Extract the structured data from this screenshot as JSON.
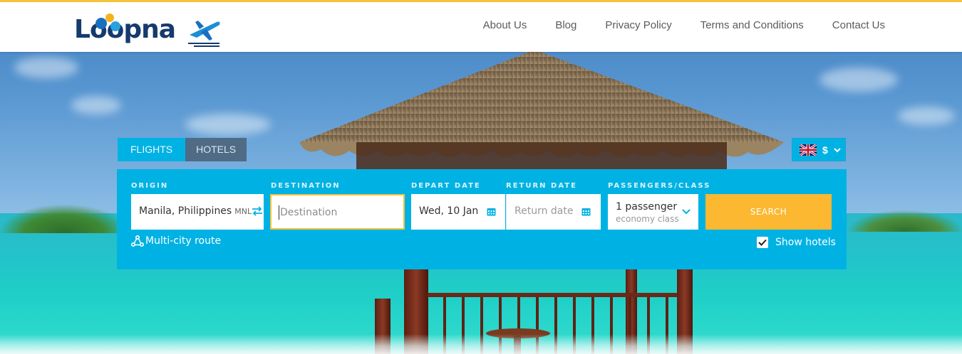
{
  "brand": {
    "logo_text": "Loopna",
    "colors": {
      "primary": "#00b2e3",
      "accent": "#f5c33b",
      "button": "#fbb830",
      "logo": "#153a6e"
    }
  },
  "nav": {
    "items": [
      "About Us",
      "Blog",
      "Privacy Policy",
      "Terms and Conditions",
      "Contact Us"
    ]
  },
  "tabs": {
    "flights": "FLIGHTS",
    "hotels": "HOTELS",
    "active": "FLIGHTS"
  },
  "currency": {
    "symbol": "$",
    "flag_icon": "uk-flag-icon"
  },
  "search": {
    "origin": {
      "label": "ORIGIN",
      "value": "Manila, Philippines",
      "code": "MNL"
    },
    "destination": {
      "label": "DESTINATION",
      "placeholder": "Destination"
    },
    "depart": {
      "label": "DEPART DATE",
      "value": "Wed, 10 Jan"
    },
    "return": {
      "label": "RETURN DATE",
      "placeholder": "Return date"
    },
    "passengers": {
      "label": "PASSENGERS/CLASS",
      "count": "1 passenger",
      "class": "economy class"
    },
    "search_button": "SEARCH",
    "multicity_label": "Multi-city route",
    "show_hotels_label": "Show hotels",
    "show_hotels_checked": true
  }
}
